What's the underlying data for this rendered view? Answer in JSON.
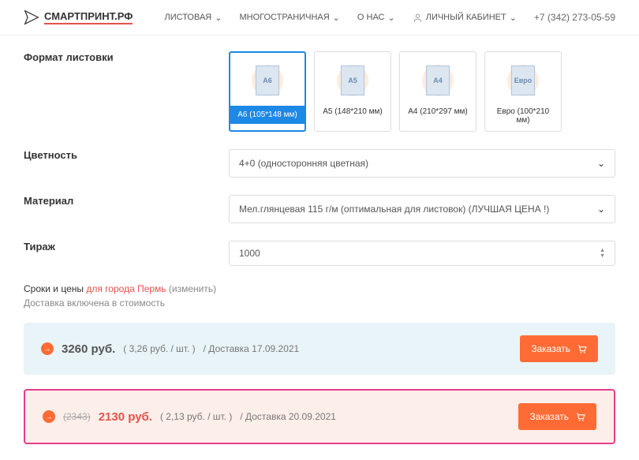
{
  "header": {
    "logo": "СМАРТПРИНТ.РФ",
    "nav": {
      "sheet": "ЛИСТОВАЯ",
      "multipage": "МНОГОСТРАНИЧНАЯ",
      "about": "О НАС",
      "account": "ЛИЧНЫЙ КАБИНЕТ"
    },
    "phone": "+7 (342) 273-05-59"
  },
  "labels": {
    "format": "Формат листовки",
    "color": "Цветность",
    "material": "Материал",
    "qty": "Тираж"
  },
  "formats": [
    {
      "thumb": "A6",
      "label": "А6 (105*148 мм)"
    },
    {
      "thumb": "A5",
      "label": "А5 (148*210 мм)"
    },
    {
      "thumb": "A4",
      "label": "А4 (210*297 мм)"
    },
    {
      "thumb": "Евро",
      "label": "Евро (100*210 мм)"
    }
  ],
  "color_value": "4+0 (односторонняя цветная)",
  "material_value": "Мел.глянцевая 115 г/м (оптимальная для листовок) (ЛУЧШАЯ ЦЕНА !)",
  "qty_value": "1000",
  "terms": {
    "title": "Сроки и цены",
    "city": "для города Пермь",
    "change": "(изменить)",
    "note": "Доставка включена в стоимость"
  },
  "prices": [
    {
      "strike": "",
      "main": "3260 руб.",
      "per": "( 3,26 руб. / шт. )",
      "delivery": "/ Доставка 17.09.2021",
      "btn": "Заказать"
    },
    {
      "strike": "(2343)",
      "main": "2130 руб.",
      "per": "( 2,13 руб. / шт. )",
      "delivery": "/ Доставка 20.09.2021",
      "btn": "Заказать"
    }
  ]
}
